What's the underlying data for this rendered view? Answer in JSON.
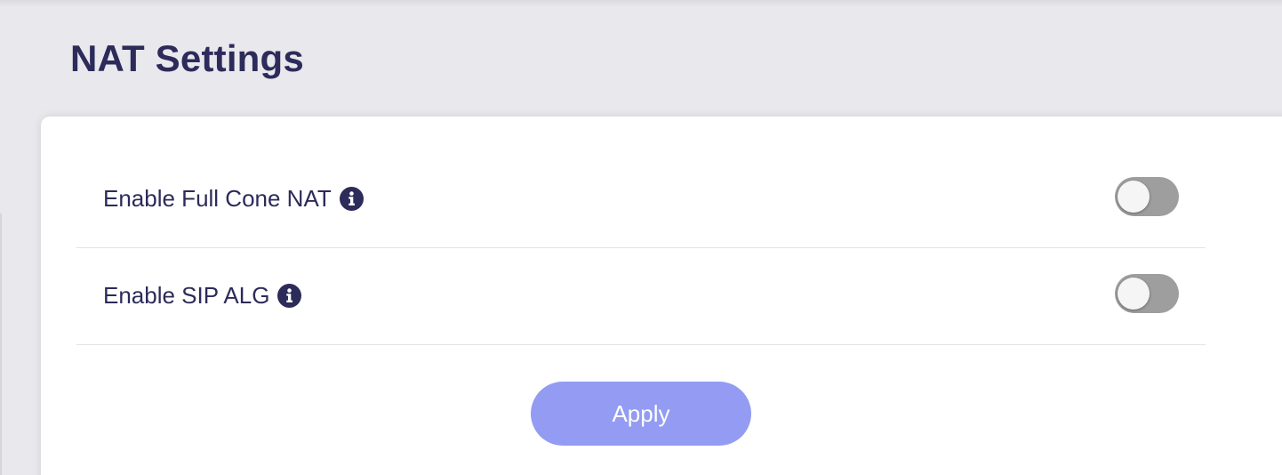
{
  "header": {
    "title": "NAT Settings"
  },
  "settings": [
    {
      "label": "Enable Full Cone NAT",
      "info_icon": "info-circle-icon",
      "enabled": false
    },
    {
      "label": "Enable SIP ALG",
      "info_icon": "info-circle-icon",
      "enabled": false
    }
  ],
  "actions": {
    "apply_label": "Apply"
  },
  "colors": {
    "title_text": "#2c2b5a",
    "toggle_off": "#9e9e9e",
    "apply_button": "#939cf2",
    "background": "#e9e8ed",
    "card": "#ffffff"
  }
}
